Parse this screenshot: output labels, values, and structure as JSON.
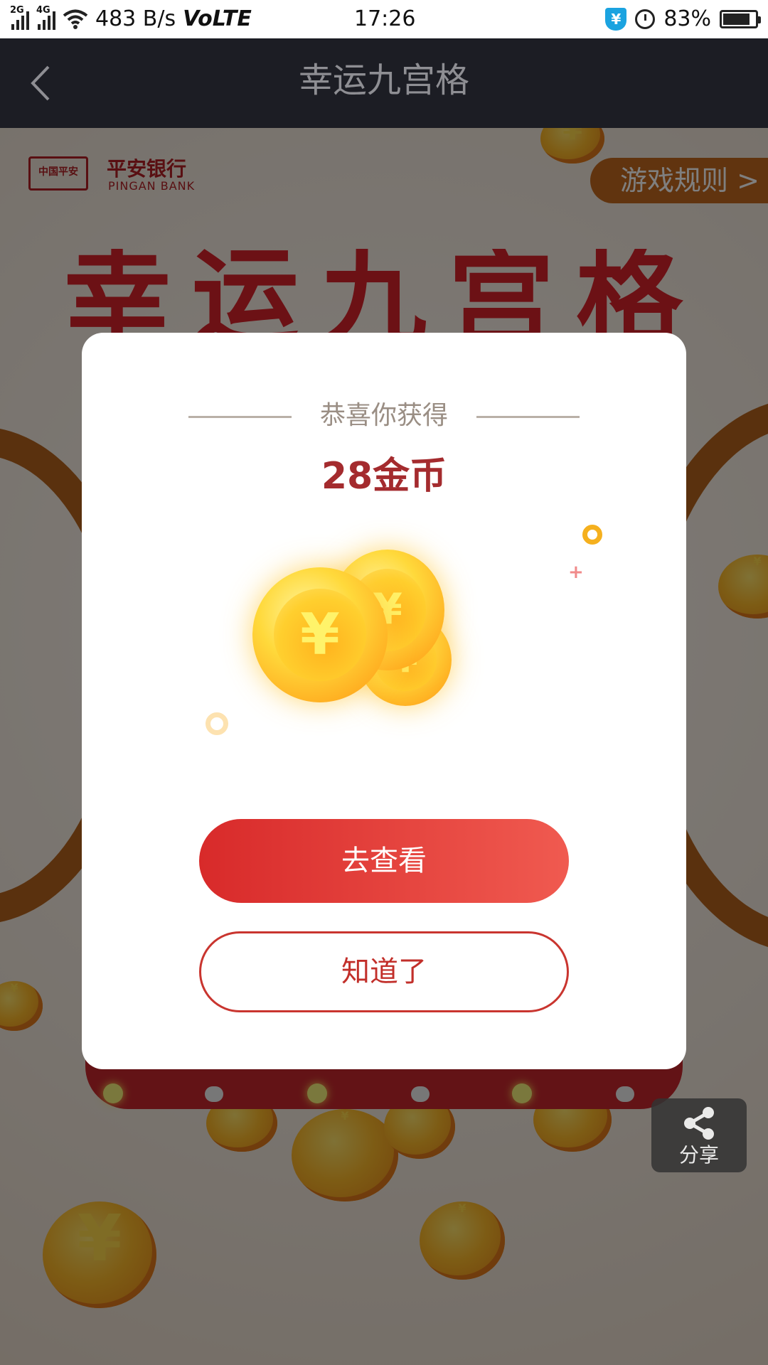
{
  "status_bar": {
    "signal_2g_label": "2G",
    "signal_4g_label": "4G",
    "network_speed": "483 B/s",
    "volte": "VoLTE",
    "time": "17:26",
    "battery_percent": "83%",
    "battery_level": 0.83,
    "icons": [
      "signal-icon",
      "wifi-icon",
      "shield-icon",
      "alarm-icon",
      "battery-icon"
    ]
  },
  "navbar": {
    "title": "幸运九宫格",
    "back_icon": "back-arrow-icon"
  },
  "page": {
    "brand_badge": "中国平安",
    "brand_name": "平安银行",
    "brand_name_en": "PINGAN BANK",
    "rules_label": "游戏规则 >",
    "game_title": "幸运九宫格",
    "share_label": "分享"
  },
  "modal": {
    "subtitle": "恭喜你获得",
    "reward": "28金币",
    "primary_button": "去查看",
    "secondary_button": "知道了"
  },
  "colors": {
    "navbar_bg": "#1c1d24",
    "primary_red": "#d82a2a",
    "reward_text": "#a42b2e",
    "rules_tab": "#c2691f"
  }
}
